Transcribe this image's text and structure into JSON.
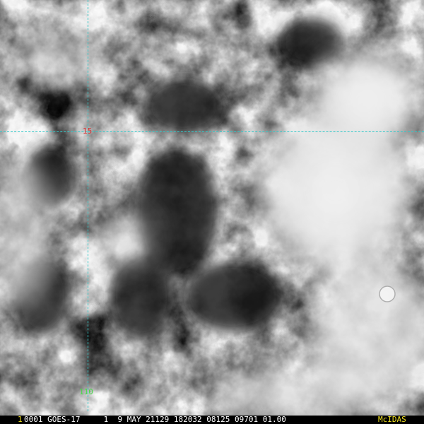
{
  "image": {
    "grid_labels": {
      "latitude": "15",
      "longitude": "110"
    }
  },
  "status_bar": {
    "frame_number": "1",
    "info": "0001 GOES-17     1  9 MAY 21129 182032 08125 09701 01.00",
    "logo": "McIDAS"
  },
  "colors": {
    "grid_line": "#35c8c8",
    "latitude_label": "#e03030",
    "longitude_label": "#48d848",
    "frame_number": "#f0e020",
    "info_text": "#ffffff",
    "logo": "#f0e020",
    "bar_background": "#000000"
  }
}
